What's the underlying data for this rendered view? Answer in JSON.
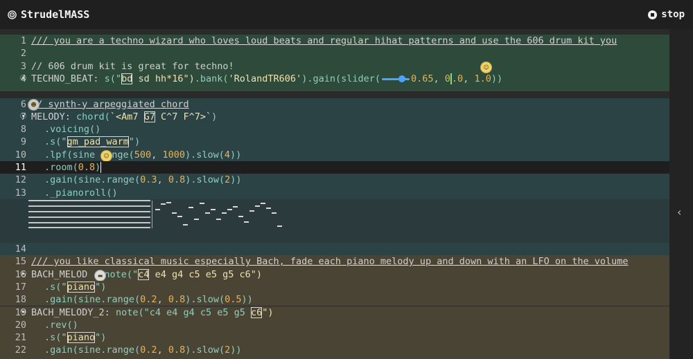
{
  "app": {
    "title": "StrudelMASS",
    "stop_label": "stop"
  },
  "editor": {
    "lines": {
      "l1": {
        "num": "1",
        "text": "/// you are a techno wizard who loves loud beats and regular hihat patterns and use the 606 drum kit you"
      },
      "l2": {
        "num": "2"
      },
      "l3": {
        "num": "3",
        "text": "// 606 drum kit is great for techno!"
      },
      "l4": {
        "num": "4",
        "name": "TECHNO_BEAT",
        "s": "s(\"",
        "tok1": "bd",
        "rest": " sd hh*16\")",
        "bank": ".bank(",
        "bankstr": "'RolandTR606'",
        "gain": ").gain(",
        "slider": "slider(",
        "v1": "0.65",
        "v2a": "0",
        "v2b": ".0",
        "v3": "1.0",
        "end": "))"
      },
      "l6": {
        "num": "6",
        "text": "// synth-y arpeggiated chord"
      },
      "l7": {
        "num": "7",
        "name": "MELODY",
        "chord": "chord(",
        "a": "`<Am7 ",
        "tok": "G7",
        "b": " C^7 F^7>`",
        "end": ")"
      },
      "l8": {
        "num": "8",
        "text": ".voicing()"
      },
      "l9": {
        "num": "9",
        "a": ".s(\"",
        "tok": "gm_pad_warm",
        "b": "\")"
      },
      "l10": {
        "num": "10",
        "a": ".lpf(sine",
        "b": "ange(",
        "n1": "500",
        "n2": "1000",
        "c": ").slow(",
        "n3": "4",
        "d": "))"
      },
      "l11": {
        "num": "11",
        "a": ".room(",
        "n": "0.8",
        "b": ")"
      },
      "l12": {
        "num": "12",
        "a": ".gain(sine.range(",
        "n1": "0.3",
        "n2": "0.8",
        "b": ").slow(",
        "n3": "2",
        "c": "))"
      },
      "l13": {
        "num": "13",
        "text": "._pianoroll()"
      },
      "l14": {
        "num": "14"
      },
      "l15": {
        "num": "15",
        "text": "/// you like classical music especially Bach, fade each piano melody up and down with an LFO on the volume"
      },
      "l16": {
        "num": "16",
        "name": "BACH_MELOD",
        "a": " note(\"",
        "tok": "c4",
        "b": " e4 g4 c5 e5 g5 c6\")"
      },
      "l17": {
        "num": "17",
        "a": ".s(\"",
        "tok": "piano",
        "b": "\")"
      },
      "l18": {
        "num": "18",
        "a": ".gain(sine.range(",
        "n1": "0.2",
        "n2": "0.8",
        "b": ").slow(",
        "n3": "0.5",
        "c": "))"
      },
      "l19": {
        "num": "19",
        "name": "BACH_MELODY_2",
        "a": " note(\"c4 e4 g4 c5 e5 g5 ",
        "tok": "c6",
        "b": "\")"
      },
      "l20": {
        "num": "20",
        "text": ".rev()"
      },
      "l21": {
        "num": "21",
        "a": ".s(\"",
        "tok": "piano",
        "b": "\")"
      },
      "l22": {
        "num": "22",
        "a": ".gain(sine.range(",
        "n1": "0.2",
        "n2": "0.8",
        "b": ").slow(",
        "n3": "2",
        "c": "))"
      }
    }
  },
  "icons": {
    "logo": "spiral-icon",
    "stop": "stop-icon",
    "collapse": "chevron-left-icon"
  },
  "colors": {
    "drums_block": "#2e4a3a",
    "melody_block": "#2c4346",
    "bach_block": "#4a4434",
    "accent_slider": "#4aa3ff"
  }
}
